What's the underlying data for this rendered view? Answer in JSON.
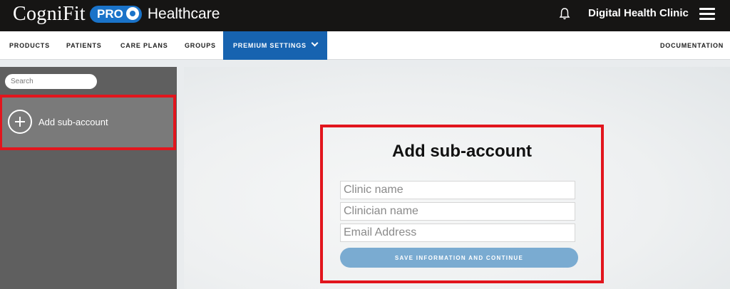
{
  "brand": {
    "name": "CogniFit",
    "pro_badge": "PRO",
    "product": "Healthcare"
  },
  "header": {
    "clinic": "Digital Health Clinic",
    "icons": [
      "bell-icon",
      "hamburger-menu-icon"
    ]
  },
  "nav": {
    "items": [
      "PRODUCTS",
      "PATIENTS",
      "CARE PLANS",
      "GROUPS"
    ],
    "active": "PREMIUM SETTINGS",
    "documentation": "DOCUMENTATION"
  },
  "sidebar": {
    "search_placeholder": "Search",
    "add_label": "Add sub-account"
  },
  "form": {
    "title": "Add sub-account",
    "clinic_placeholder": "Clinic name",
    "clinician_placeholder": "Clinician name",
    "email_placeholder": "Email Address",
    "submit": "SAVE INFORMATION AND CONTINUE"
  },
  "colors": {
    "accent": "#1763b0",
    "highlight": "#e2151d",
    "button": "#7aabd1",
    "topbar": "#161514"
  }
}
